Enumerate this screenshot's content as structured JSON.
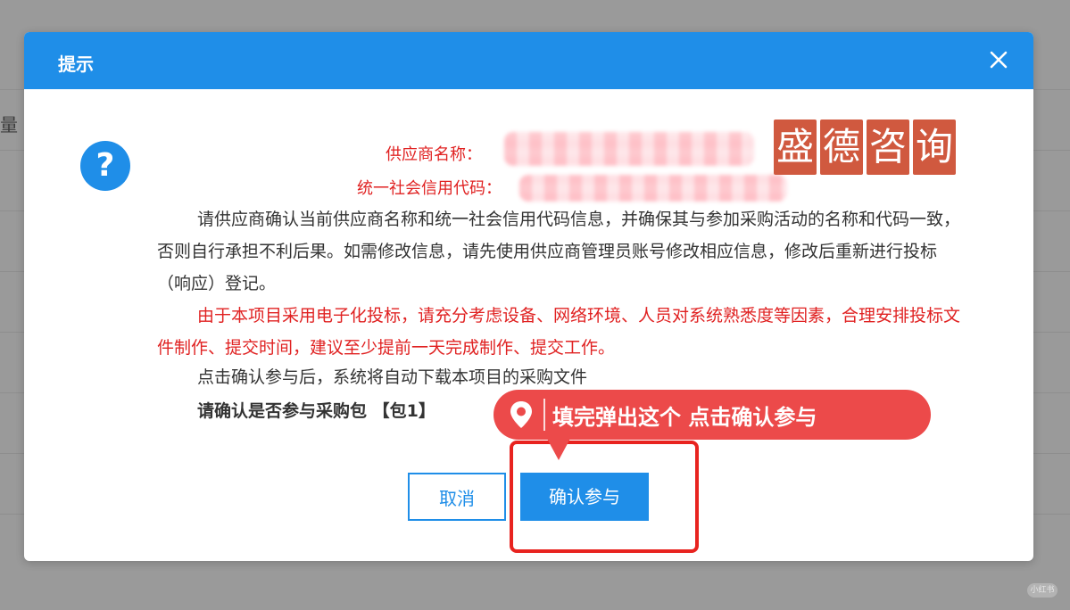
{
  "background": {
    "glyph": "量",
    "watermark": "小红书"
  },
  "dialog": {
    "title": "提示",
    "close_icon": "close-icon",
    "question_icon_text": "?",
    "supplier_name_label": "供应商名称：",
    "credit_code_label": "统一社会信用代码：",
    "stamp_chars": [
      "盛",
      "德",
      "咨",
      "询"
    ],
    "para1": "请供应商确认当前供应商名称和统一社会信用代码信息，并确保其与参加采购活动的名称和代码一致，否则自行承担不利后果。如需修改信息，请先使用供应商管理员账号修改相应信息，修改后重新进行投标（响应）登记。",
    "para2": "由于本项目采用电子化投标，请充分考虑设备、网络环境、人员对系统熟悉度等因素，合理安排投标文件制作、提交时间，建议至少提前一天完成制作、提交工作。",
    "para3": "点击确认参与后，系统将自动下载本项目的采购文件",
    "confirm_question": "请确认是否参与采购包 【包1】",
    "cancel_label": "取消",
    "confirm_label": "确认参与"
  },
  "annotation": {
    "callout_text": "填完弹出这个  点击确认参与",
    "pin_icon": "location-pin-icon"
  },
  "colors": {
    "header_blue": "#1f8ee8",
    "warning_red": "#e02222",
    "annotation_red": "#ec4a4a",
    "stamp_red": "#d0593f"
  }
}
